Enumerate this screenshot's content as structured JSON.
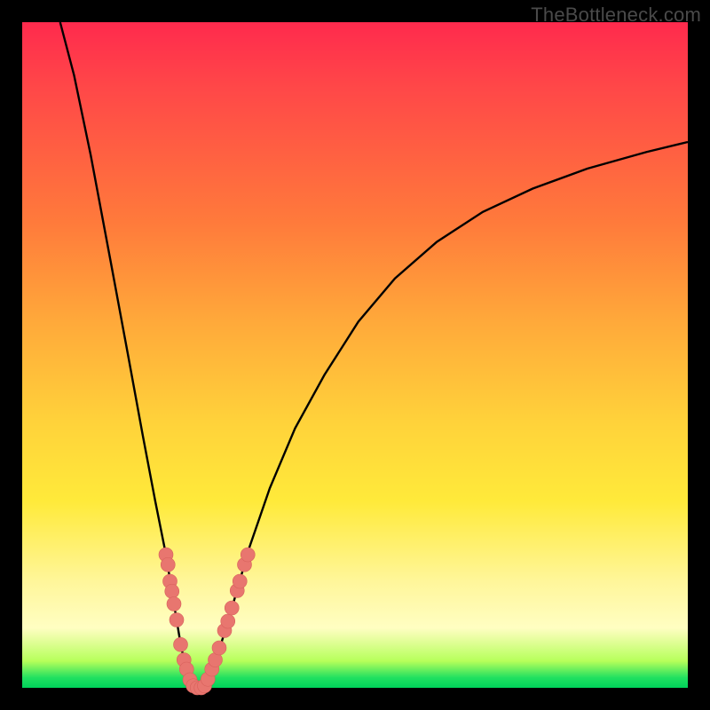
{
  "watermark": "TheBottleneck.com",
  "chart_data": {
    "type": "line",
    "title": "",
    "xlabel": "",
    "ylabel": "",
    "xlim": [
      0,
      100
    ],
    "ylim": [
      0,
      100
    ],
    "series": [
      {
        "name": "bottleneck-curve",
        "points": [
          {
            "x": 5.7,
            "y": 100
          },
          {
            "x": 7.8,
            "y": 92
          },
          {
            "x": 10.3,
            "y": 80
          },
          {
            "x": 13.3,
            "y": 64
          },
          {
            "x": 15.9,
            "y": 50
          },
          {
            "x": 18.1,
            "y": 38
          },
          {
            "x": 20.0,
            "y": 28
          },
          {
            "x": 21.6,
            "y": 20
          },
          {
            "x": 22.9,
            "y": 12
          },
          {
            "x": 23.9,
            "y": 6
          },
          {
            "x": 24.9,
            "y": 2
          },
          {
            "x": 26.0,
            "y": 0
          },
          {
            "x": 27.1,
            "y": 0
          },
          {
            "x": 28.4,
            "y": 2.5
          },
          {
            "x": 30.0,
            "y": 7
          },
          {
            "x": 31.8,
            "y": 13
          },
          {
            "x": 34.1,
            "y": 21
          },
          {
            "x": 37.2,
            "y": 30
          },
          {
            "x": 41.0,
            "y": 39
          },
          {
            "x": 45.4,
            "y": 47
          },
          {
            "x": 50.5,
            "y": 55
          },
          {
            "x": 56.0,
            "y": 61.5
          },
          {
            "x": 62.3,
            "y": 67
          },
          {
            "x": 69.2,
            "y": 71.5
          },
          {
            "x": 76.7,
            "y": 75
          },
          {
            "x": 84.9,
            "y": 78
          },
          {
            "x": 93.8,
            "y": 80.5
          },
          {
            "x": 100,
            "y": 82
          }
        ]
      },
      {
        "name": "markers-left",
        "points": [
          {
            "x": 21.6,
            "y": 20.0
          },
          {
            "x": 21.9,
            "y": 18.5
          },
          {
            "x": 22.2,
            "y": 16.0
          },
          {
            "x": 22.5,
            "y": 14.5
          },
          {
            "x": 22.8,
            "y": 12.6
          },
          {
            "x": 23.2,
            "y": 10.2
          },
          {
            "x": 23.8,
            "y": 6.5
          },
          {
            "x": 24.3,
            "y": 4.2
          },
          {
            "x": 24.7,
            "y": 2.8
          },
          {
            "x": 25.2,
            "y": 1.2
          }
        ]
      },
      {
        "name": "markers-bottom",
        "points": [
          {
            "x": 25.7,
            "y": 0.3
          },
          {
            "x": 26.3,
            "y": 0.0
          },
          {
            "x": 26.9,
            "y": 0.0
          },
          {
            "x": 27.4,
            "y": 0.3
          }
        ]
      },
      {
        "name": "markers-right",
        "points": [
          {
            "x": 27.9,
            "y": 1.3
          },
          {
            "x": 28.5,
            "y": 2.8
          },
          {
            "x": 29.0,
            "y": 4.2
          },
          {
            "x": 29.6,
            "y": 6.0
          },
          {
            "x": 30.4,
            "y": 8.6
          },
          {
            "x": 30.9,
            "y": 10.0
          },
          {
            "x": 31.5,
            "y": 12.0
          },
          {
            "x": 32.3,
            "y": 14.6
          },
          {
            "x": 32.7,
            "y": 16.0
          },
          {
            "x": 33.4,
            "y": 18.5
          },
          {
            "x": 33.9,
            "y": 20.0
          }
        ]
      }
    ]
  }
}
